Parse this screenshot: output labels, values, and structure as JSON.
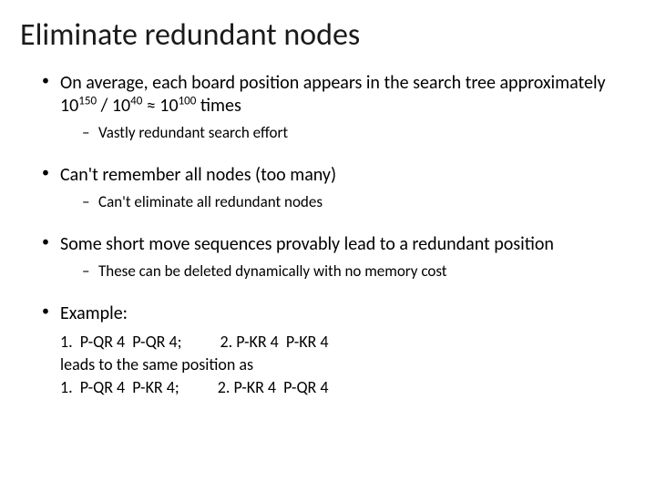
{
  "title": "Eliminate redundant nodes",
  "bullets": [
    {
      "text_pre": "On average, each board position appears in the search tree approximately 10",
      "sup1": "150",
      "mid1": " / 10",
      "sup2": "40",
      "mid2": " ≈ 10",
      "sup3": "100",
      "text_post": " times",
      "sub": [
        "Vastly redundant search effort"
      ]
    },
    {
      "text": "Can't remember all nodes (too many)",
      "sub": [
        "Can't eliminate all redundant nodes"
      ]
    },
    {
      "text": "Some short move sequences provably lead to a redundant position",
      "sub": [
        "These can be deleted dynamically with no memory cost"
      ]
    },
    {
      "text": "Example:",
      "example": {
        "line1a": "1.  P-QR 4  P-QR 4;",
        "line1b": "2. P-KR 4  P-KR 4",
        "line2": "leads to the same position as",
        "line3a": "1.  P-QR 4  P-KR 4;",
        "line3b": "2. P-KR 4  P-QR 4"
      }
    }
  ]
}
